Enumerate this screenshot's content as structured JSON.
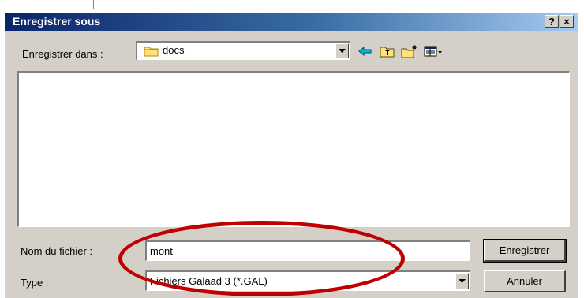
{
  "window": {
    "title": "Enregistrer sous",
    "help_label": "?",
    "close_label": "×"
  },
  "lookin": {
    "label": "Enregistrer dans :",
    "value": "docs",
    "folder_icon": "folder-icon"
  },
  "toolbar": {
    "icons": [
      "back-arrow-icon",
      "up-folder-icon",
      "new-folder-icon",
      "view-menu-icon"
    ]
  },
  "filename": {
    "label": "Nom du fichier :",
    "value": "mont"
  },
  "type": {
    "label": "Type :",
    "value": "Fichiers Galaad 3 (*.GAL)"
  },
  "buttons": {
    "save": "Enregistrer",
    "cancel": "Annuler"
  },
  "colors": {
    "title_start": "#0a246a",
    "title_end": "#a6caf0",
    "dialog_bg": "#d4d0c8",
    "annotation": "#c00000"
  }
}
